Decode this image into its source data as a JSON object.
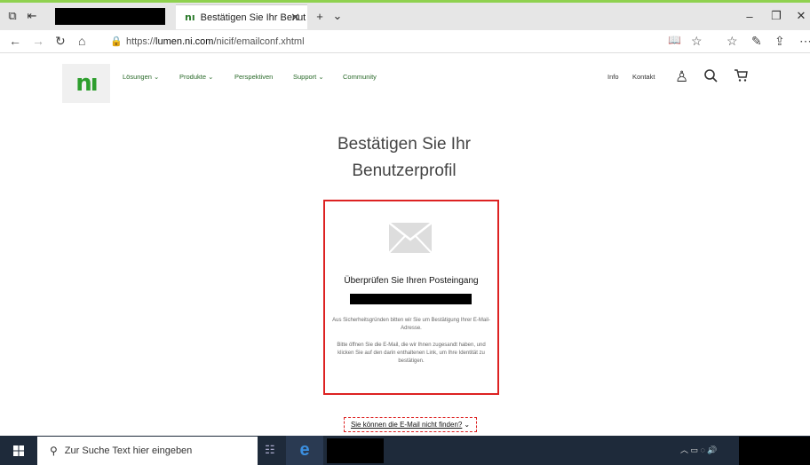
{
  "browser": {
    "tab_title": "Bestätigen Sie Ihr Benut",
    "tab_logo": "nı",
    "url_prefix": "https://",
    "url_host": "lumen.ni.com",
    "url_path": "/nicif/emailconf.xhtml"
  },
  "site": {
    "logo": "nı",
    "nav": [
      "Lösungen ⌄",
      "Produkte ⌄",
      "Perspektiven",
      "Support ⌄",
      "Community"
    ],
    "nav_right": [
      "Info",
      "Kontakt"
    ]
  },
  "page": {
    "title_line1": "Bestätigen Sie Ihr",
    "title_line2": "Benutzerprofil",
    "card_heading": "Überprüfen Sie Ihren Posteingang",
    "card_text1": "Aus Sicherheitsgründen bitten wir Sie um Bestätigung Ihrer E-Mail-Adresse.",
    "card_text2": "Bitte öffnen Sie die E-Mail, die wir Ihnen zugesandt haben, und klicken Sie auf den darin enthaltenen Link, um Ihre Identität zu bestätigen.",
    "find_link": "Sie können die E-Mail nicht finden?"
  },
  "taskbar": {
    "search_placeholder": "Zur Suche Text hier eingeben"
  },
  "colors": {
    "brand_green": "#2d9e2d",
    "highlight_red": "#dd2222",
    "taskbar": "#1e2a3a"
  }
}
